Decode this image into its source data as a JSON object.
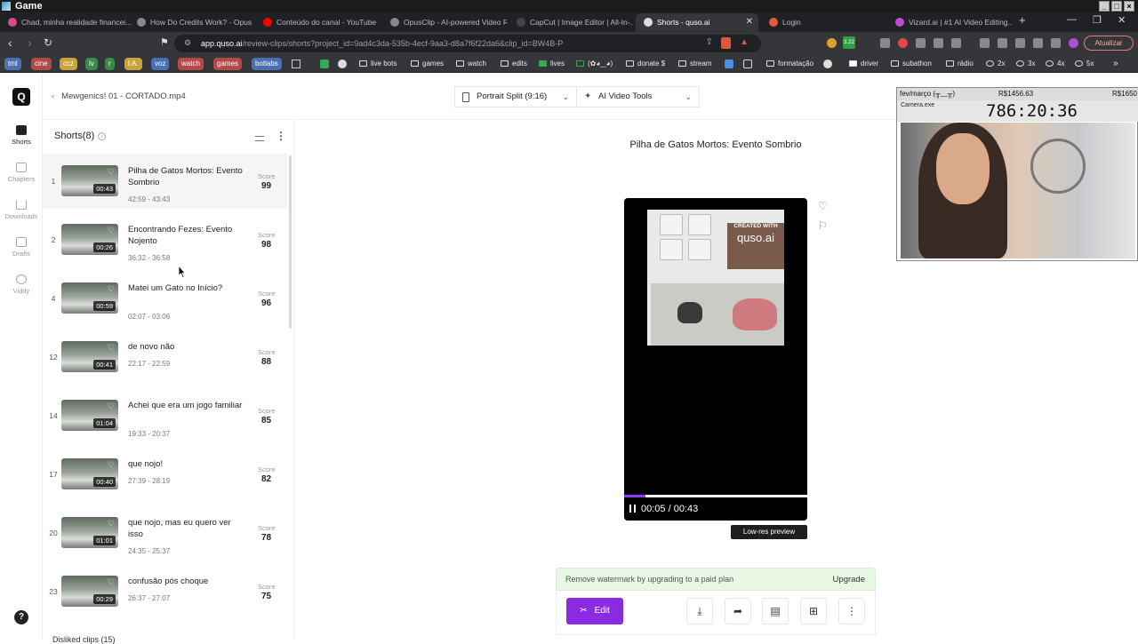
{
  "window": {
    "title": "Game"
  },
  "tabs": [
    {
      "label": "Chad, minha realidade financei...",
      "color": "#d94b8a"
    },
    {
      "label": "How Do Credits Work? - Opus...",
      "color": "#888"
    },
    {
      "label": "Conteúdo do canal - YouTube",
      "color": "#ff0000"
    },
    {
      "label": "OpusClip - AI-powered Video R...",
      "color": "#888"
    },
    {
      "label": "CapCut | Image Editor | All-In-...",
      "color": "#222"
    },
    {
      "label": "Shorts - quso.ai",
      "color": "#222",
      "active": true
    },
    {
      "label": "Login",
      "color": "#e25b3a"
    },
    {
      "label": "Vizard.ai | #1 AI Video Editing...",
      "color": "#c04ccf"
    }
  ],
  "address": {
    "host": "app.quso.ai",
    "path": "/review-clips/shorts?project_id=9ad4c3da-535b-4ecf-9aa3-d8a7f6f22da6&clip_id=BW4B-P"
  },
  "update_label": "Atualizar",
  "ext_badge": "3.22",
  "bookmarks": [
    {
      "label": "tml",
      "color": "#4a6fb3"
    },
    {
      "label": "cine",
      "color": "#b34a4a"
    },
    {
      "label": "ccz",
      "color": "#c9a43a"
    },
    {
      "label": "lv",
      "color": "#3a8b4a"
    },
    {
      "label": "r",
      "color": "#3a8b4a"
    },
    {
      "label": "l.A.",
      "color": "#c9a43a"
    },
    {
      "label": "voz",
      "color": "#4a6fb3"
    },
    {
      "label": "watch",
      "color": "#b34a4a"
    },
    {
      "label": "games",
      "color": "#b34a4a"
    },
    {
      "label": "botlabs",
      "color": "#4a6fb3"
    },
    {
      "label": "live bots"
    },
    {
      "label": "games"
    },
    {
      "label": "watch"
    },
    {
      "label": "edits"
    },
    {
      "label": "lives"
    },
    {
      "label": "(✿◕‿◕)"
    },
    {
      "label": "donate $"
    },
    {
      "label": "stream"
    },
    {
      "label": "formatação"
    },
    {
      "label": "driver"
    },
    {
      "label": "subathon"
    },
    {
      "label": "rádio"
    },
    {
      "label": "2x"
    },
    {
      "label": "3x"
    },
    {
      "label": "4x"
    },
    {
      "label": "5x"
    }
  ],
  "rail": [
    {
      "label": "Shorts",
      "active": true
    },
    {
      "label": "Chapters"
    },
    {
      "label": "Downloads"
    },
    {
      "label": "Drafts"
    },
    {
      "label": "Viddy"
    }
  ],
  "breadcrumb": "Mewgenics! 01 - CORTADO.mp4",
  "layout_dropdown": "Portrait Split (9:16)",
  "tools_dropdown": "AI Video Tools",
  "shorts_header": "Shorts(8)",
  "score_label": "Score",
  "clips": [
    {
      "num": "1",
      "title": "Pilha de Gatos Mortos: Evento Sombrio",
      "range": "42:59 - 43:43",
      "dur": "00:43",
      "score": "99"
    },
    {
      "num": "2",
      "title": "Encontrando Fezes: Evento Nojento",
      "range": "36:32 - 36:58",
      "dur": "00:26",
      "score": "98"
    },
    {
      "num": "4",
      "title": "Matei um Gato no Início?",
      "range": "02:07 - 03:06",
      "dur": "00:59",
      "score": "96"
    },
    {
      "num": "12",
      "title": "de novo não",
      "range": "22:17 - 22:59",
      "dur": "00:41",
      "score": "88"
    },
    {
      "num": "14",
      "title": "Achei que era um jogo familiar",
      "range": "19:33 - 20:37",
      "dur": "01:04",
      "score": "85"
    },
    {
      "num": "17",
      "title": "que nojo!",
      "range": "27:39 - 28:19",
      "dur": "00:40",
      "score": "82"
    },
    {
      "num": "20",
      "title": "que nojo, mas eu quero ver isso",
      "range": "24:35 - 25:37",
      "dur": "01:01",
      "score": "78"
    },
    {
      "num": "23",
      "title": "confusão pós choque",
      "range": "26:37 - 27:07",
      "dur": "00:29",
      "score": "75"
    }
  ],
  "disliked": "Disliked clips (15)",
  "preview": {
    "title": "Pilha de Gatos Mortos: Evento Sombrio",
    "watermark_small": "CREATED WITH",
    "watermark_brand": "quso.ai",
    "time": "00:05 / 00:43",
    "progress": 0.116,
    "lowres": "Low-res preview"
  },
  "watermark_notice": "Remove watermark by upgrading to a paid plan",
  "upgrade": "Upgrade",
  "edit": "Edit",
  "overlay": {
    "label": "fev/março (╥﹏╥)",
    "amount1": "R$1456.63",
    "amount2": "R$1650",
    "cam_title": "Camera.exe",
    "timer": "786:20:36"
  }
}
